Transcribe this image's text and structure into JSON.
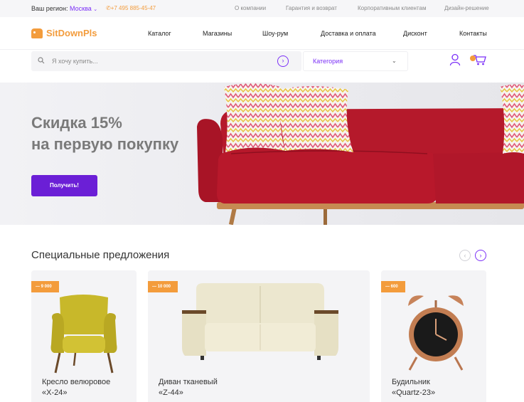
{
  "topbar": {
    "region_label": "Ваш регион:",
    "city": "Москва",
    "phone": "+7 495 885-45-47",
    "links": [
      "О компании",
      "Гарантия и возврат",
      "Корпоративным клиентам",
      "Дизайн-решение"
    ]
  },
  "header": {
    "logo": "SitDownPls",
    "nav": [
      "Каталог",
      "Магазины",
      "Шоу-рум",
      "Доставка и оплата",
      "Дисконт",
      "Контакты"
    ]
  },
  "search": {
    "placeholder": "Я хочу купить...",
    "category": "Категория"
  },
  "hero": {
    "line1": "Скидка 15%",
    "line2": "на первую покупку",
    "cta": "Получить!"
  },
  "specials": {
    "title": "Специальные предложения",
    "items": [
      {
        "badge": "— 9 000",
        "name1": "Кресло велюровое",
        "name2": "«X-24»"
      },
      {
        "badge": "— 10 000",
        "name1": "Диван тканевый",
        "name2": "«Z-44»"
      },
      {
        "badge": "— 600",
        "name1": "Будильник",
        "name2": "«Quartz-23»"
      }
    ]
  },
  "colors": {
    "accent": "#7b2ff7",
    "button": "#6b1fd6",
    "orange": "#f39c3c",
    "sofa": "#b5192b"
  }
}
